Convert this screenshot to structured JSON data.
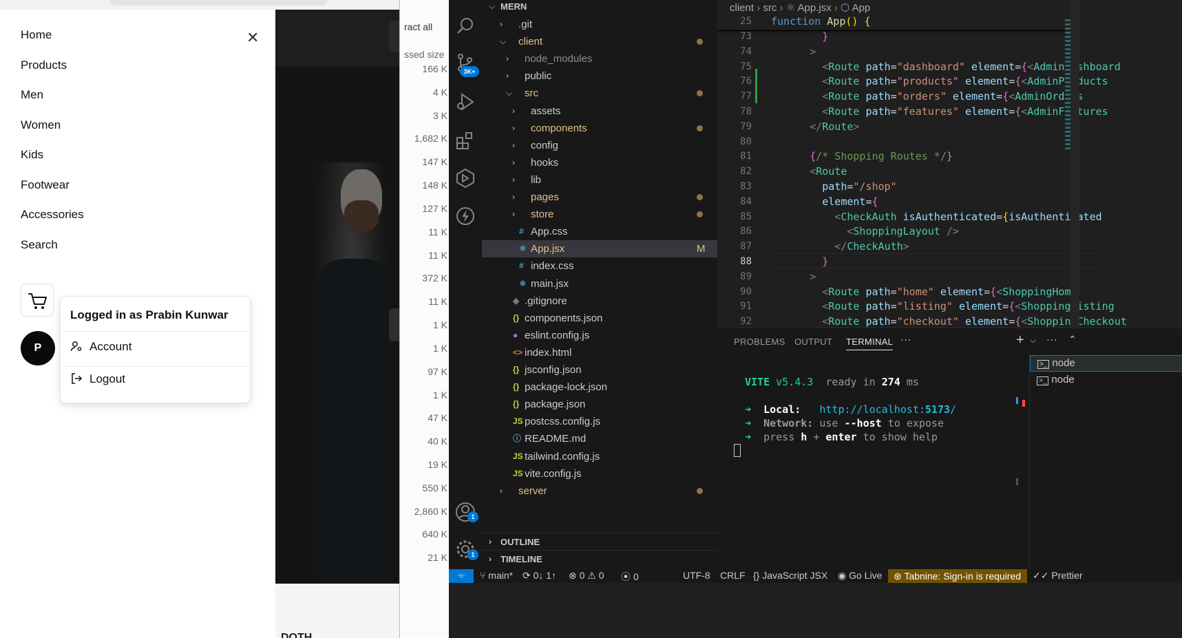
{
  "browser": {
    "nav_items": [
      "Home",
      "Products",
      "Men",
      "Women",
      "Kids",
      "Footwear",
      "Accessories",
      "Search"
    ],
    "avatar_initial": "P",
    "dropdown": {
      "header": "Logged in as Prabin Kunwar",
      "account": "Account",
      "logout": "Logout"
    },
    "bottom_text": "DOTH",
    "accent": "#0a0a0a"
  },
  "explorer": {
    "extract_all": "ract all",
    "compressed_size": "ssed size",
    "sizes": [
      "166 K",
      "4 K",
      "3 K",
      "1,682 K",
      "147 K",
      "148 K",
      "127 K",
      "11 K",
      "11 K",
      "372 K",
      "11 K",
      "1 K",
      "1 K",
      "97 K",
      "1 K",
      "47 K",
      "40 K",
      "19 K",
      "550 K",
      "2,860 K",
      "640 K",
      "21 K"
    ]
  },
  "activity_bar": {
    "source_control_badge": "3K+",
    "accounts_badge": "1",
    "settings_badge": "1"
  },
  "sidebar": {
    "root": "MERN",
    "tree": [
      {
        "label": ".git",
        "depth": 1,
        "type": "folder",
        "open": false,
        "color": "#cccccc",
        "dot": false
      },
      {
        "label": "client",
        "depth": 1,
        "type": "folder",
        "open": true,
        "color": "#e2c08d",
        "dot": true
      },
      {
        "label": "node_modules",
        "depth": 2,
        "type": "folder",
        "open": false,
        "color": "#8c8c8c",
        "dot": false
      },
      {
        "label": "public",
        "depth": 2,
        "type": "folder",
        "open": false,
        "color": "#cccccc",
        "dot": false
      },
      {
        "label": "src",
        "depth": 2,
        "type": "folder",
        "open": true,
        "color": "#e2c08d",
        "dot": true
      },
      {
        "label": "assets",
        "depth": 3,
        "type": "folder",
        "open": false,
        "color": "#cccccc",
        "dot": false
      },
      {
        "label": "components",
        "depth": 3,
        "type": "folder",
        "open": false,
        "color": "#e2c08d",
        "dot": true
      },
      {
        "label": "config",
        "depth": 3,
        "type": "folder",
        "open": false,
        "color": "#cccccc",
        "dot": false
      },
      {
        "label": "hooks",
        "depth": 3,
        "type": "folder",
        "open": false,
        "color": "#cccccc",
        "dot": false
      },
      {
        "label": "lib",
        "depth": 3,
        "type": "folder",
        "open": false,
        "color": "#cccccc",
        "dot": false
      },
      {
        "label": "pages",
        "depth": 3,
        "type": "folder",
        "open": false,
        "color": "#e2c08d",
        "dot": true
      },
      {
        "label": "store",
        "depth": 3,
        "type": "folder",
        "open": false,
        "color": "#e2c08d",
        "dot": true
      },
      {
        "label": "App.css",
        "depth": 3,
        "type": "file",
        "icon": "#",
        "iconColor": "#519aba",
        "color": "#cccccc"
      },
      {
        "label": "App.jsx",
        "depth": 3,
        "type": "file",
        "icon": "⚛",
        "iconColor": "#519aba",
        "color": "#e2c08d",
        "badge": "M",
        "selected": true
      },
      {
        "label": "index.css",
        "depth": 3,
        "type": "file",
        "icon": "#",
        "iconColor": "#519aba",
        "color": "#cccccc"
      },
      {
        "label": "main.jsx",
        "depth": 3,
        "type": "file",
        "icon": "⚛",
        "iconColor": "#519aba",
        "color": "#cccccc"
      },
      {
        "label": ".gitignore",
        "depth": 2,
        "type": "file",
        "icon": "◆",
        "iconColor": "#6d8086",
        "color": "#cccccc"
      },
      {
        "label": "components.json",
        "depth": 2,
        "type": "file",
        "icon": "{}",
        "iconColor": "#cbcb41",
        "color": "#cccccc"
      },
      {
        "label": "eslint.config.js",
        "depth": 2,
        "type": "file",
        "icon": "●",
        "iconColor": "#a074c4",
        "color": "#cccccc"
      },
      {
        "label": "index.html",
        "depth": 2,
        "type": "file",
        "icon": "<>",
        "iconColor": "#e37933",
        "color": "#cccccc"
      },
      {
        "label": "jsconfig.json",
        "depth": 2,
        "type": "file",
        "icon": "{}",
        "iconColor": "#cbcb41",
        "color": "#cccccc"
      },
      {
        "label": "package-lock.json",
        "depth": 2,
        "type": "file",
        "icon": "{}",
        "iconColor": "#cbcb41",
        "color": "#cccccc"
      },
      {
        "label": "package.json",
        "depth": 2,
        "type": "file",
        "icon": "{}",
        "iconColor": "#cbcb41",
        "color": "#cccccc"
      },
      {
        "label": "postcss.config.js",
        "depth": 2,
        "type": "file",
        "icon": "JS",
        "iconColor": "#cbcb41",
        "color": "#cccccc"
      },
      {
        "label": "README.md",
        "depth": 2,
        "type": "file",
        "icon": "ⓘ",
        "iconColor": "#519aba",
        "color": "#cccccc"
      },
      {
        "label": "tailwind.config.js",
        "depth": 2,
        "type": "file",
        "icon": "JS",
        "iconColor": "#cbcb41",
        "color": "#cccccc"
      },
      {
        "label": "vite.config.js",
        "depth": 2,
        "type": "file",
        "icon": "JS",
        "iconColor": "#cbcb41",
        "color": "#cccccc"
      },
      {
        "label": "server",
        "depth": 1,
        "type": "folder",
        "open": false,
        "color": "#e2c08d",
        "dot": true
      }
    ],
    "outline": "OUTLINE",
    "timeline": "TIMELINE"
  },
  "editor": {
    "breadcrumb": [
      "client",
      "src",
      "App.jsx",
      "App"
    ],
    "sticky_line": "25",
    "line_numbers": [
      "73",
      "74",
      "75",
      "76",
      "77",
      "78",
      "79",
      "80",
      "81",
      "82",
      "83",
      "84",
      "85",
      "86",
      "87",
      "88",
      "89",
      "90",
      "91",
      "92"
    ],
    "current_line": "88"
  },
  "panel": {
    "tabs": [
      "PROBLEMS",
      "OUTPUT",
      "TERMINAL"
    ],
    "active_tab": "TERMINAL",
    "more": "···",
    "terminal": {
      "vite": "VITE",
      "version": "v5.4.3",
      "ready": "ready in",
      "ms_value": "274",
      "ms": "ms",
      "local_label": "Local:",
      "local_url_base": "http://localhost:",
      "local_port": "5173",
      "local_slash": "/",
      "network_label": "Network:",
      "network_use": "use",
      "network_host": "--host",
      "network_rest": "to expose",
      "press": "press",
      "h": "h",
      "plus": "+",
      "enter": "enter",
      "help": "to show help"
    },
    "terminals": [
      "node",
      "node"
    ]
  },
  "status_bar": {
    "branch": "main*",
    "sync": "0↓ 1↑",
    "errors": "0",
    "warnings": "0",
    "ports": "0",
    "encoding": "UTF-8",
    "eol": "CRLF",
    "language": "JavaScript JSX",
    "golive": "Go Live",
    "tabnine": "Tabnine: Sign-in is required",
    "prettier": "Prettier",
    "remote_color": "#0078d4"
  }
}
